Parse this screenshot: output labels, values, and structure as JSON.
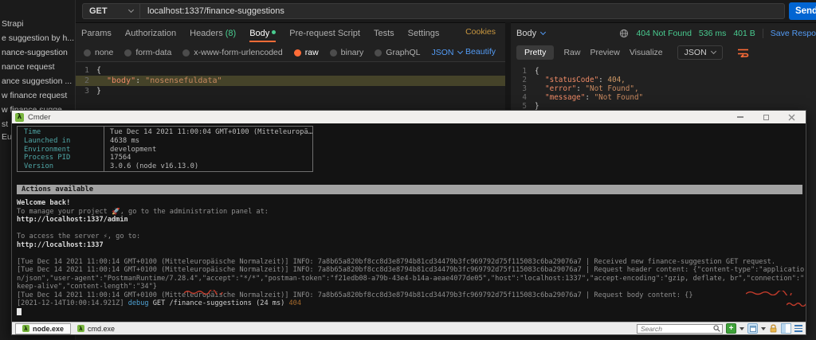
{
  "postman": {
    "sidebar": {
      "items": [
        "Strapi",
        "e suggestion by h...",
        "nance-suggestion",
        "nance request",
        "ance suggestion ...",
        "w finance request",
        "w finance sugge...",
        "st",
        "Eurc"
      ]
    },
    "request": {
      "method": "GET",
      "url": "localhost:1337/finance-suggestions",
      "send_label": "Send",
      "tabs": {
        "params": "Params",
        "auth": "Authorization",
        "headers": "Headers",
        "headers_count": "(8)",
        "body": "Body",
        "prerequest": "Pre-request Script",
        "tests": "Tests",
        "settings": "Settings"
      },
      "cookies_label": "Cookies",
      "modes": {
        "none": "none",
        "formdata": "form-data",
        "urlencoded": "x-www-form-urlencoded",
        "raw": "raw",
        "binary": "binary",
        "graphql": "GraphQL"
      },
      "language": "JSON",
      "beautify_label": "Beautify",
      "editor": {
        "line_numbers": [
          "1",
          "2",
          "3"
        ],
        "l1": "{",
        "l2_key": "\"body\"",
        "l2_colon": ": ",
        "l2_value": "\"nosensefuldata\"",
        "l3": "}"
      }
    },
    "response": {
      "body_label": "Body",
      "status": "404 Not Found",
      "time": "536 ms",
      "size": "401 B",
      "save_label": "Save Respo",
      "tabs": {
        "pretty": "Pretty",
        "raw": "Raw",
        "preview": "Preview",
        "visualize": "Visualize"
      },
      "language": "JSON",
      "editor": {
        "line_numbers": [
          "1",
          "2",
          "3",
          "4",
          "5"
        ],
        "l1": "{",
        "l2_key": "\"statusCode\"",
        "l2_colon": ": ",
        "l2_value": "404,",
        "l3_key": "\"error\"",
        "l3_colon": ": ",
        "l3_value": "\"Not Found\",",
        "l4_key": "\"message\"",
        "l4_colon": ": ",
        "l4_value": "\"Not Found\"",
        "l5": "}"
      }
    }
  },
  "terminal": {
    "title": "Cmder",
    "info_table": {
      "rows": [
        [
          "Time",
          "Tue Dec 14 2021 11:00:04 GMT+0100 (Mitteleuropä…"
        ],
        [
          "Launched in",
          "4638 ms"
        ],
        [
          "Environment",
          "development"
        ],
        [
          "Process PID",
          "17564"
        ],
        [
          "Version",
          "3.0.6 (node v16.13.0)"
        ]
      ]
    },
    "actions_bar": "Actions available",
    "welcome": {
      "l1": "Welcome back!",
      "l2": "To manage your project 🚀, go to the administration panel at:",
      "l3": "http://localhost:1337/admin",
      "l4": "To access the server ⚡, go to:",
      "l5": "http://localhost:1337"
    },
    "logs": {
      "info1": "[Tue Dec 14 2021 11:00:14 GMT+0100 (Mitteleuropäische Normalzeit)] INFO: 7a8b65a820bf8cc8d3e8794b81cd34479b3fc969792d75f115083c6ba29076a7 | Received new finance-suggestion GET request.",
      "info2a": "[Tue Dec 14 2021 11:00:14 GMT+0100 (Mitteleuropäische Normalzeit)] INFO: 7a8b65a820bf8cc8d3e8794b81cd34479b3fc969792d75f115083c6ba29076a7 | Request header content: {\"content-type\":\"applicatio",
      "info2b": "n/json\",\"user-agent\":\"PostmanRuntime/7.28.4\",\"accept\":\"*/*\",\"postman-token\":\"f21edb08-a79b-43e4-b14a-aeae4077de05\",\"host\":\"localhost:1337\",\"accept-encoding\":\"gzip, deflate, br\",\"connection\":\"",
      "info2c": "keep-alive\",\"content-length\":\"34\"}",
      "info3": "[Tue Dec 14 2021 11:00:14 GMT+0100 (Mitteleuropäische Normalzeit)] INFO: 7a8b65a820bf8cc8d3e8794b81cd34479b3fc969792d75f115083c6ba29076a7 | Request body content: {}",
      "debug_ts": "[2021-12-14T10:00:14.921Z] ",
      "debug_level": "debug",
      "debug_msg": " GET /finance-suggestions (24 ms) ",
      "debug_code": "404"
    },
    "statusbar": {
      "tabs": [
        "node.exe",
        "cmd.exe"
      ],
      "search_placeholder": "Search"
    }
  }
}
